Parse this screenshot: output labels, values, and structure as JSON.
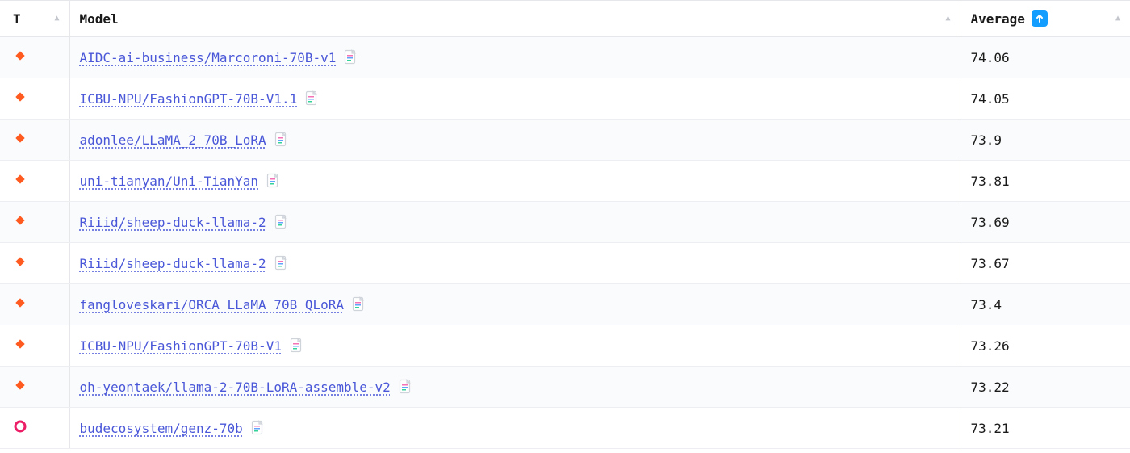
{
  "columns": {
    "type": "T",
    "model": "Model",
    "average": "Average"
  },
  "rows": [
    {
      "type": "finetuned",
      "model": "AIDC-ai-business/Marcoroni-70B-v1",
      "average": "74.06"
    },
    {
      "type": "finetuned",
      "model": "ICBU-NPU/FashionGPT-70B-V1.1",
      "average": "74.05"
    },
    {
      "type": "finetuned",
      "model": "adonlee/LLaMA_2_70B_LoRA",
      "average": "73.9"
    },
    {
      "type": "finetuned",
      "model": "uni-tianyan/Uni-TianYan",
      "average": "73.81"
    },
    {
      "type": "finetuned",
      "model": "Riiid/sheep-duck-llama-2",
      "average": "73.69"
    },
    {
      "type": "finetuned",
      "model": "Riiid/sheep-duck-llama-2",
      "average": "73.67"
    },
    {
      "type": "finetuned",
      "model": "fangloveskari/ORCA_LLaMA_70B_QLoRA",
      "average": "73.4"
    },
    {
      "type": "finetuned",
      "model": "ICBU-NPU/FashionGPT-70B-V1",
      "average": "73.26"
    },
    {
      "type": "finetuned",
      "model": "oh-yeontaek/llama-2-70B-LoRA-assemble-v2",
      "average": "73.22"
    },
    {
      "type": "pretrained",
      "model": "budecosystem/genz-70b",
      "average": "73.21"
    }
  ]
}
